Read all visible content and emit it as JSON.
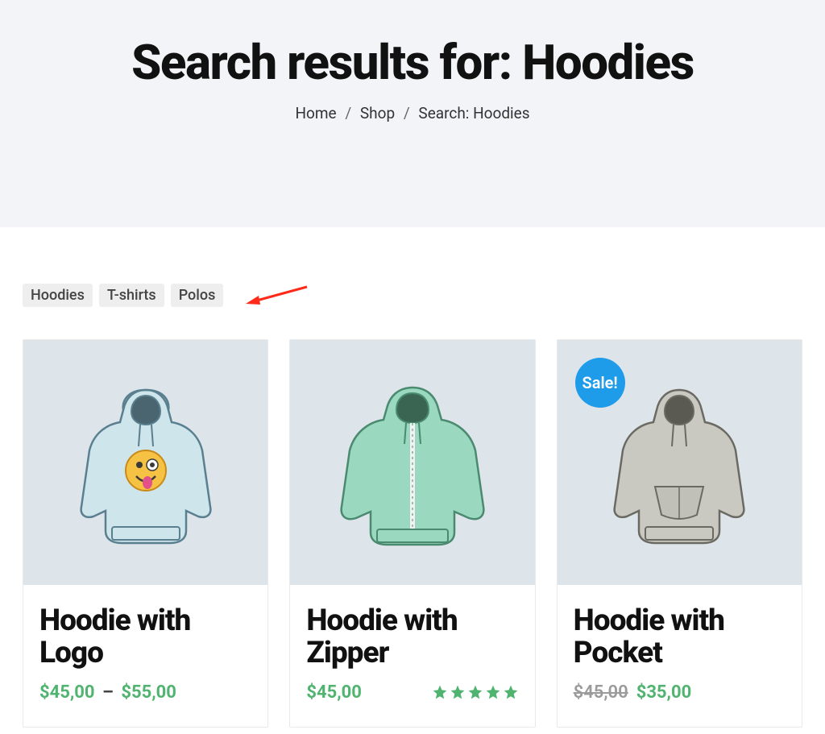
{
  "header": {
    "title_prefix": "Search results for: ",
    "query": "Hoodies"
  },
  "breadcrumb": {
    "home": "Home",
    "shop": "Shop",
    "current": "Search: Hoodies",
    "sep": "/"
  },
  "filter_pills": [
    "Hoodies",
    "T-shirts",
    "Polos"
  ],
  "sale_label": "Sale!",
  "products": [
    {
      "title": "Hoodie with Logo",
      "price_low": "45,00",
      "price_high": "55,00",
      "currency": "$",
      "has_range": true,
      "on_sale": false,
      "rating": 0
    },
    {
      "title": "Hoodie with Zipper",
      "price": "45,00",
      "currency": "$",
      "has_range": false,
      "on_sale": false,
      "rating": 5
    },
    {
      "title": "Hoodie with Pocket",
      "original_price": "45,00",
      "price": "35,00",
      "currency": "$",
      "has_range": false,
      "on_sale": true,
      "rating": 0
    }
  ]
}
